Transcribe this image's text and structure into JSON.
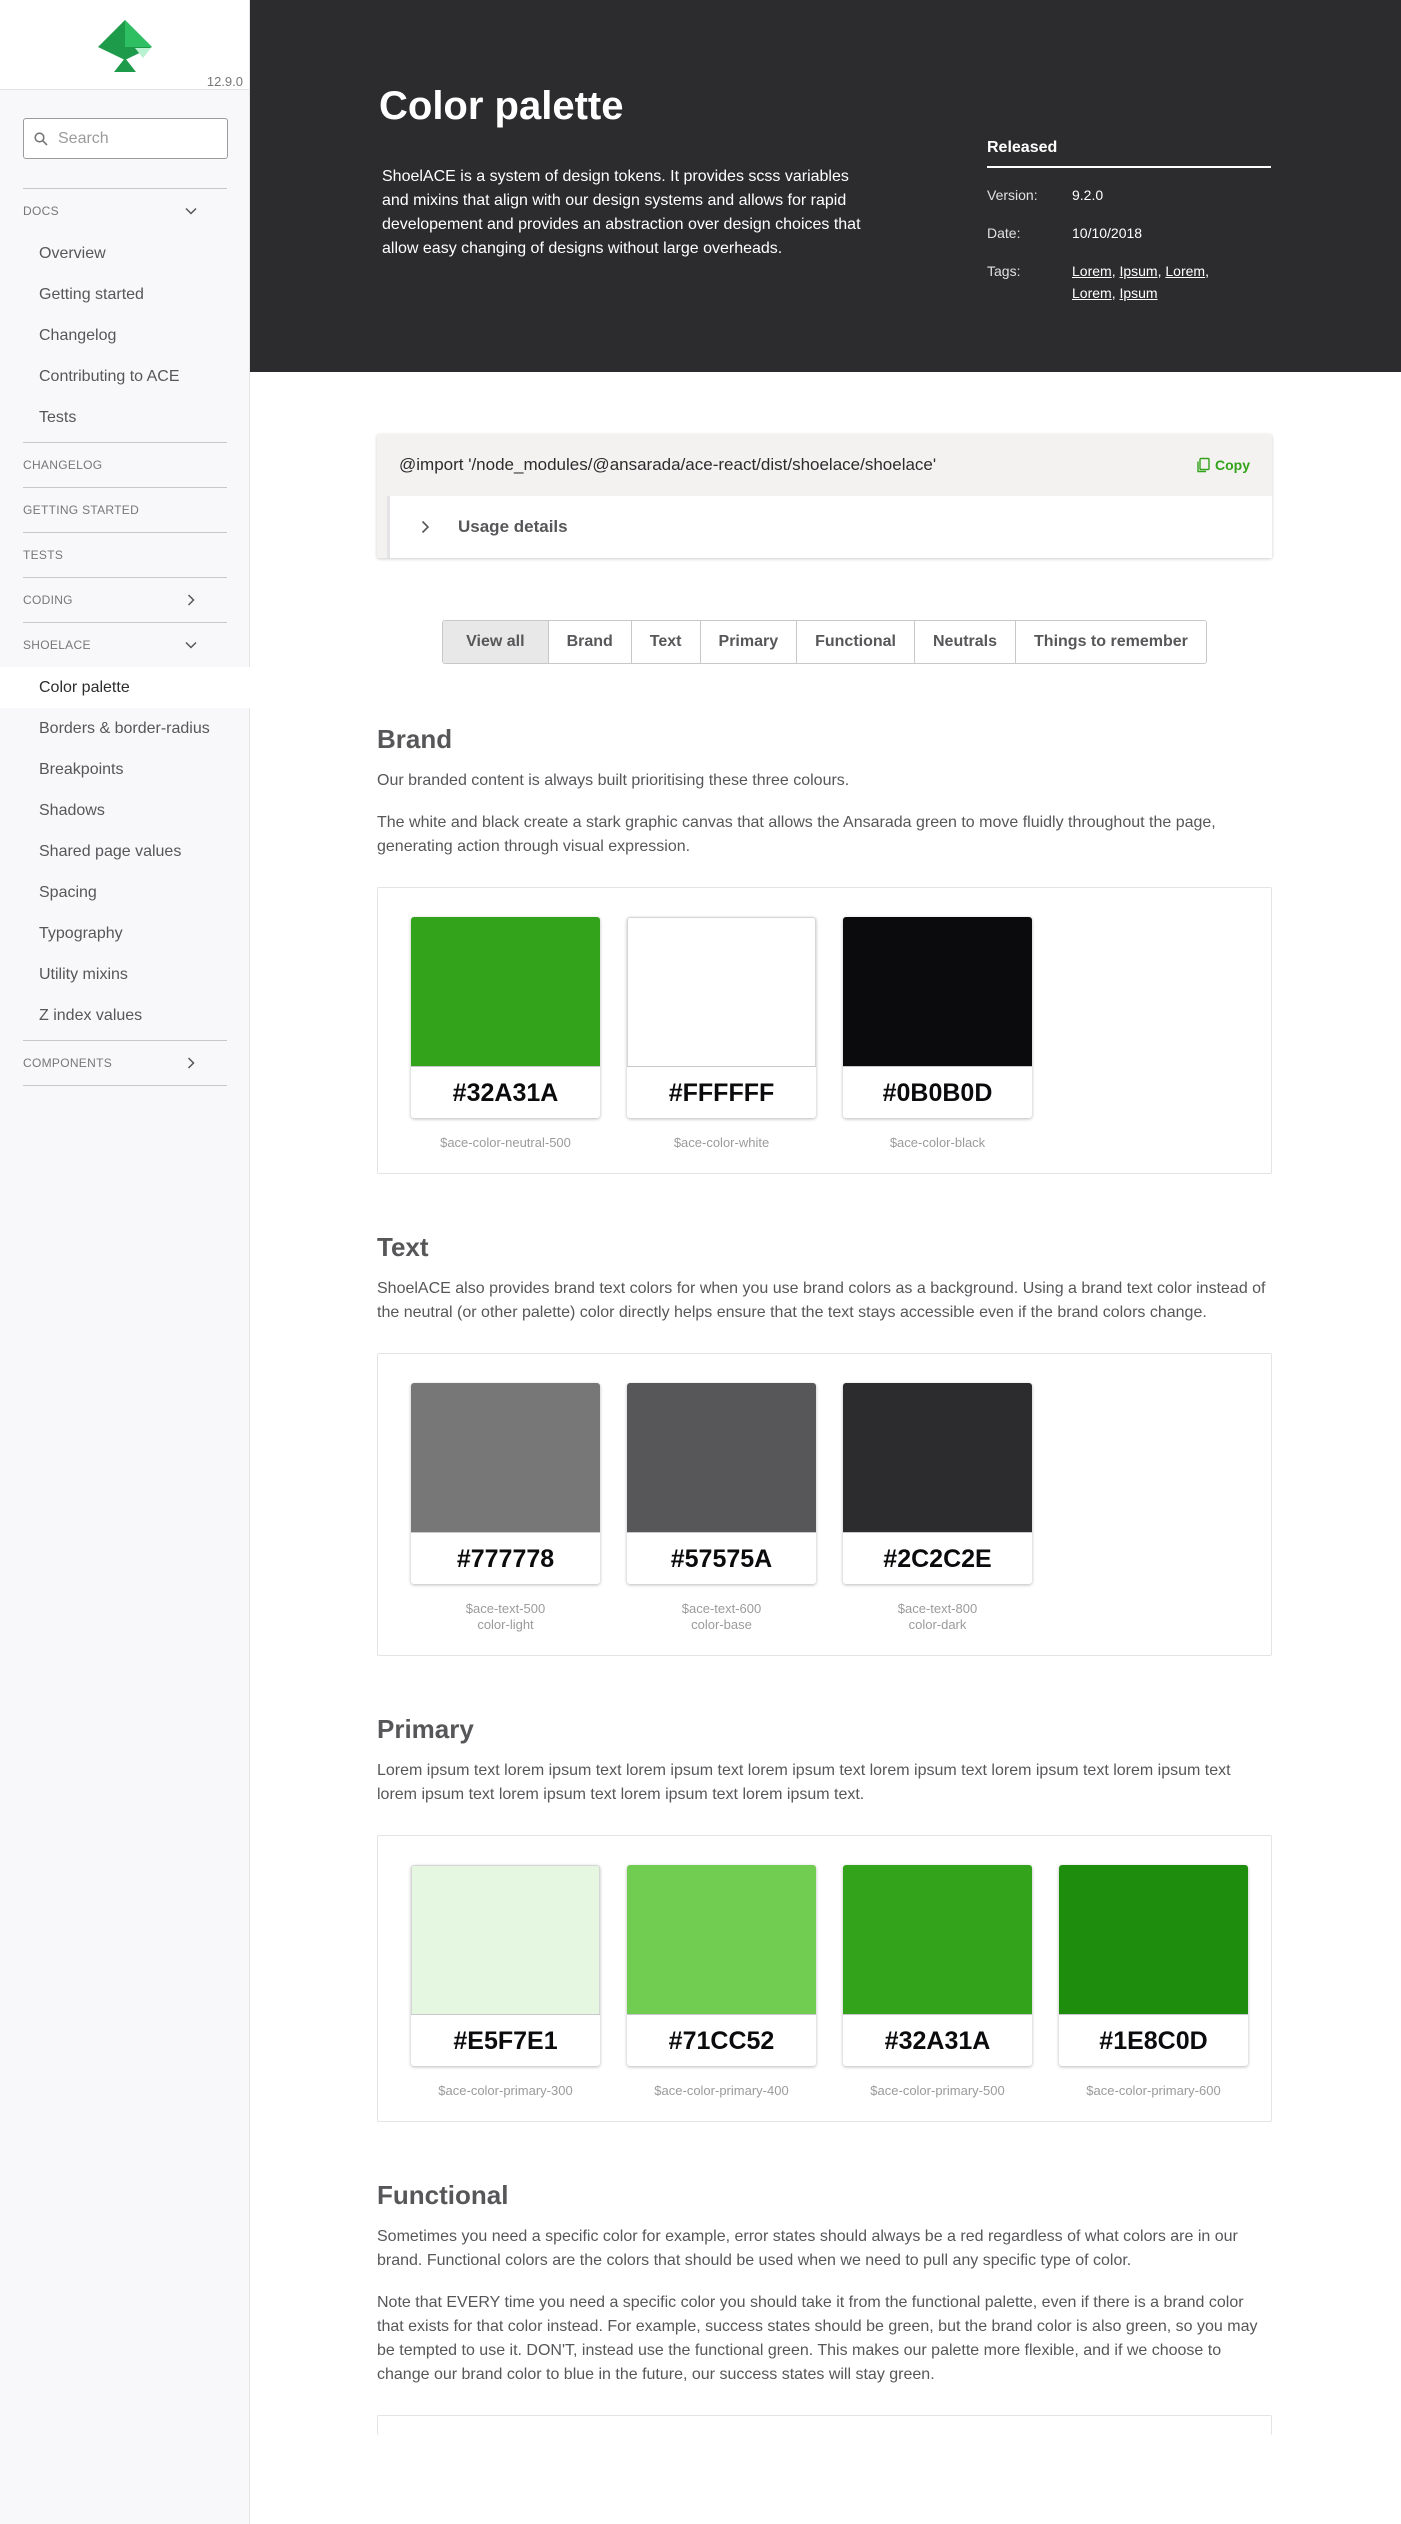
{
  "sidebar": {
    "version": "12.9.0",
    "search_placeholder": "Search",
    "docs": {
      "label": "DOCS",
      "items": [
        "Overview",
        "Getting started",
        "Changelog",
        "Contributing to ACE",
        "Tests"
      ]
    },
    "changelog": "CHANGELOG",
    "getting_started": "GETTING STARTED",
    "tests": "TESTS",
    "coding": "CODING",
    "shoelace": {
      "label": "SHOELACE",
      "items": [
        "Color palette",
        "Borders & border-radius",
        "Breakpoints",
        "Shadows",
        "Shared page values",
        "Spacing",
        "Typography",
        "Utility mixins",
        "Z index values"
      ]
    },
    "components": "COMPONENTS"
  },
  "header": {
    "title": "Color palette",
    "intro": "ShoelACE is a system of design tokens. It provides scss variables and mixins that align with our design systems and allows for rapid developement and provides an abstraction over design choices that allow easy changing of designs without large overheads.",
    "meta_title": "Released",
    "version_label": "Version:",
    "version": "9.2.0",
    "date_label": "Date:",
    "date": "10/10/2018",
    "tags_label": "Tags:",
    "tags": [
      "Lorem",
      "Ipsum",
      "Lorem",
      "Lorem",
      "Ipsum"
    ]
  },
  "import": {
    "code": "@import '/node_modules/@ansarada/ace-react/dist/shoelace/shoelace'",
    "copy_label": "Copy",
    "usage_label": "Usage details"
  },
  "tabs": [
    "View all",
    "Brand",
    "Text",
    "Primary",
    "Functional",
    "Neutrals",
    "Things to remember"
  ],
  "brand": {
    "title": "Brand",
    "p1": "Our branded content is always built prioritising these three colours.",
    "p2": "The white and black create a stark graphic canvas that allows the Ansarada green to move fluidly throughout the page, generating action through visual expression.",
    "swatches": [
      {
        "hex": "#32A31A",
        "var": "$ace-color-neutral-500",
        "color": "#32A31A"
      },
      {
        "hex": "#FFFFFF",
        "var": "$ace-color-white",
        "color": "#FFFFFF"
      },
      {
        "hex": "#0B0B0D",
        "var": "$ace-color-black",
        "color": "#0B0B0D"
      }
    ]
  },
  "text": {
    "title": "Text",
    "p1": "ShoelACE also provides brand text colors for when you use brand colors as a background. Using a brand text color instead of the neutral (or other palette) color directly helps ensure that the text stays accessible even if the brand colors change.",
    "swatches": [
      {
        "hex": "#777778",
        "var": "$ace-text-500",
        "var2": "color-light",
        "color": "#777778"
      },
      {
        "hex": "#57575A",
        "var": "$ace-text-600",
        "var2": "color-base",
        "color": "#57575A"
      },
      {
        "hex": "#2C2C2E",
        "var": "$ace-text-800",
        "var2": "color-dark",
        "color": "#2C2C2E"
      }
    ]
  },
  "primary": {
    "title": "Primary",
    "p1": "Lorem ipsum text lorem ipsum text lorem ipsum text lorem ipsum text lorem ipsum text lorem ipsum text lorem ipsum text lorem ipsum text lorem ipsum text lorem ipsum text lorem ipsum text.",
    "swatches": [
      {
        "hex": "#E5F7E1",
        "var": "$ace-color-primary-300",
        "color": "#E5F7E1"
      },
      {
        "hex": "#71CC52",
        "var": "$ace-color-primary-400",
        "color": "#71CC52"
      },
      {
        "hex": "#32A31A",
        "var": "$ace-color-primary-500",
        "color": "#32A31A"
      },
      {
        "hex": "#1E8C0D",
        "var": "$ace-color-primary-600",
        "color": "#1E8C0D"
      }
    ]
  },
  "functional": {
    "title": "Functional",
    "p1": "Sometimes you need a specific color for example, error states should always be a red regardless of what colors are in our brand. Functional colors are the colors that should be used when we need to pull any specific type of color.",
    "p2": "Note that EVERY time you need a specific color you should take it from the functional palette, even if there is a brand color that exists for that color instead. For example, success states should be green, but the brand color is also green, so you may be tempted to use it. DON'T, instead use the functional green. This makes our palette more flexible, and if we choose to change our brand color to blue in the future, our success states will stay green."
  },
  "colors": {
    "accent": "#32A31A",
    "header_bg": "#2C2C2E",
    "sidebar_bg": "#F8F8FA"
  }
}
